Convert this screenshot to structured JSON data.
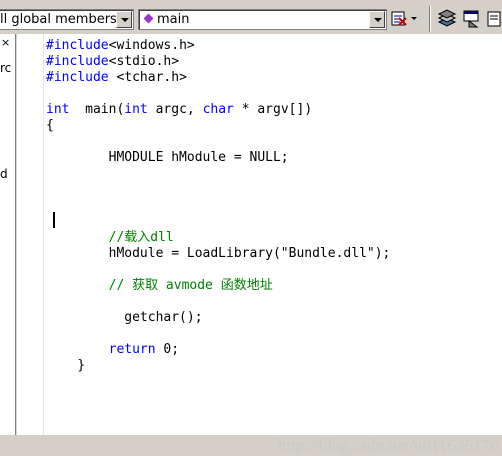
{
  "toolbar": {
    "scope_combo": "ll global members",
    "function_combo": "main"
  },
  "left_pane": {
    "close_glyph": "×",
    "fragments": [
      "rc",
      "d"
    ]
  },
  "code": [
    {
      "t": "#include<windows.h>",
      "c": "pre"
    },
    {
      "t": "#include<stdio.h>",
      "c": "pre"
    },
    {
      "t": "#include <tchar.h>",
      "c": "pre"
    },
    {
      "t": "",
      "c": "plain"
    },
    {
      "t": "int  main(int argc, char * argv[])",
      "c": "sig"
    },
    {
      "t": "{",
      "c": "plain"
    },
    {
      "t": "",
      "c": "plain"
    },
    {
      "t": "        HMODULE hModule = NULL;",
      "c": "plain"
    },
    {
      "t": "",
      "c": "plain"
    },
    {
      "t": "",
      "c": "plain"
    },
    {
      "t": "",
      "c": "plain"
    },
    {
      "t": "",
      "c": "plain"
    },
    {
      "t": "        //载入dll",
      "c": "comment"
    },
    {
      "t": "        hModule = LoadLibrary(\"Bundle.dll\");",
      "c": "plain"
    },
    {
      "t": "",
      "c": "plain"
    },
    {
      "t": "        // 获取 avmode 函数地址",
      "c": "comment"
    },
    {
      "t": "",
      "c": "plain"
    },
    {
      "t": "          getchar();",
      "c": "plain"
    },
    {
      "t": "",
      "c": "plain"
    },
    {
      "t": "        return 0;",
      "c": "ret"
    },
    {
      "t": "    }",
      "c": "plain"
    }
  ],
  "watermark": "http://blog.csdn.net/u011636170",
  "colors": {
    "keyword": "#0000ff",
    "comment": "#008000",
    "text": "#000000",
    "chrome": "#d4d0c8"
  },
  "icons": [
    "chevron-down-icon",
    "function-diamond-icon",
    "wizard-bar-icon",
    "stack-icon",
    "run-icon",
    "close-icon"
  ]
}
